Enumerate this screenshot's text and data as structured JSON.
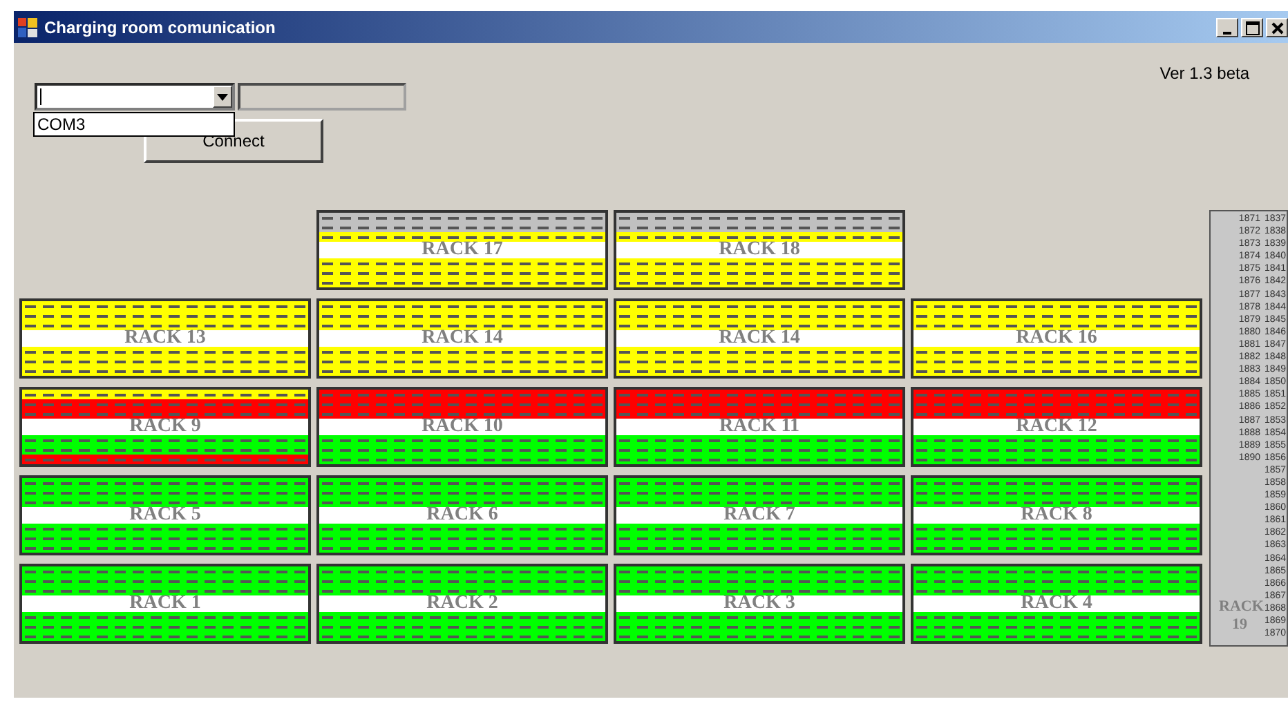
{
  "window": {
    "title": "Charging room comunication"
  },
  "port_select": {
    "expanded": true,
    "options": [
      "COM3"
    ]
  },
  "status_field": {
    "disabled": true
  },
  "connect_button": {
    "label": "Connect"
  },
  "version": "Ver 1.3 beta",
  "rack_rows": [
    {
      "racks": [
        {
          "label": "RACK 17",
          "strips": [
            {
              "color": "#c0c0c0"
            },
            {
              "color": "#c0c0c0"
            },
            {
              "color": "#ffff00"
            },
            {
              "color": "#ffff00"
            },
            {
              "color": "#ffff00"
            },
            {
              "color": "#ffff00"
            }
          ]
        },
        {
          "label": "RACK 18",
          "strips": [
            {
              "color": "#c0c0c0"
            },
            {
              "color": "#c0c0c0"
            },
            {
              "color": "#ffff00"
            },
            {
              "color": "#ffff00"
            },
            {
              "color": "#ffff00"
            },
            {
              "color": "#ffff00"
            }
          ]
        }
      ]
    },
    {
      "racks": [
        {
          "label": "RACK 13",
          "strips": [
            {
              "color": "#ffff00"
            },
            {
              "color": "#ffff00"
            },
            {
              "color": "#ffff00"
            },
            {
              "color": "#ffff00"
            },
            {
              "color": "#ffff00"
            },
            {
              "color": "#ffff00"
            }
          ]
        },
        {
          "label": "RACK 14",
          "strips": [
            {
              "color": "#ffff00"
            },
            {
              "color": "#ffff00"
            },
            {
              "color": "#ffff00"
            },
            {
              "color": "#ffff00"
            },
            {
              "color": "#ffff00"
            },
            {
              "color": "#ffff00"
            }
          ]
        },
        {
          "label": "RACK 14",
          "strips": [
            {
              "color": "#ffff00"
            },
            {
              "color": "#ffff00"
            },
            {
              "color": "#ffff00"
            },
            {
              "color": "#ffff00"
            },
            {
              "color": "#ffff00"
            },
            {
              "color": "#ffff00"
            }
          ]
        },
        {
          "label": "RACK 16",
          "strips": [
            {
              "color": "#ffff00"
            },
            {
              "color": "#ffff00"
            },
            {
              "color": "#ffff00"
            },
            {
              "color": "#ffff00"
            },
            {
              "color": "#ffff00"
            },
            {
              "color": "#ffff00"
            }
          ]
        }
      ]
    },
    {
      "racks": [
        {
          "label": "RACK 9",
          "strips": [
            {
              "color": "#ffff00"
            },
            {
              "color": "#ff0000"
            },
            {
              "color": "#ff0000"
            },
            {
              "color": "#00ff00"
            },
            {
              "color": "#00ff00"
            },
            {
              "color": "#ff0000"
            }
          ]
        },
        {
          "label": "RACK 10",
          "strips": [
            {
              "color": "#ff0000"
            },
            {
              "color": "#ff0000"
            },
            {
              "color": "#ff0000"
            },
            {
              "color": "#00ff00"
            },
            {
              "color": "#00ff00"
            },
            {
              "color": "#00ff00"
            }
          ]
        },
        {
          "label": "RACK 11",
          "strips": [
            {
              "color": "#ff0000"
            },
            {
              "color": "#ff0000"
            },
            {
              "color": "#ff0000"
            },
            {
              "color": "#00ff00"
            },
            {
              "color": "#00ff00"
            },
            {
              "color": "#00ff00"
            }
          ]
        },
        {
          "label": "RACK 12",
          "strips": [
            {
              "color": "#ff0000"
            },
            {
              "color": "#ff0000"
            },
            {
              "color": "#ff0000"
            },
            {
              "color": "#00ff00"
            },
            {
              "color": "#00ff00"
            },
            {
              "color": "#00ff00"
            }
          ]
        }
      ]
    },
    {
      "racks": [
        {
          "label": "RACK 5",
          "strips": [
            {
              "color": "#00ff00"
            },
            {
              "color": "#00ff00"
            },
            {
              "color": "#00ff00"
            },
            {
              "color": "#00ff00"
            },
            {
              "color": "#00ff00"
            },
            {
              "color": "#00ff00"
            }
          ]
        },
        {
          "label": "RACK 6",
          "strips": [
            {
              "color": "#00ff00"
            },
            {
              "color": "#00ff00"
            },
            {
              "color": "#00ff00"
            },
            {
              "color": "#00ff00"
            },
            {
              "color": "#00ff00"
            },
            {
              "color": "#00ff00"
            }
          ]
        },
        {
          "label": "RACK 7",
          "strips": [
            {
              "color": "#00ff00"
            },
            {
              "color": "#00ff00"
            },
            {
              "color": "#00ff00"
            },
            {
              "color": "#00ff00"
            },
            {
              "color": "#00ff00"
            },
            {
              "color": "#00ff00"
            }
          ]
        },
        {
          "label": "RACK 8",
          "strips": [
            {
              "color": "#00ff00"
            },
            {
              "color": "#00ff00"
            },
            {
              "color": "#00ff00"
            },
            {
              "color": "#00ff00"
            },
            {
              "color": "#00ff00"
            },
            {
              "color": "#00ff00"
            }
          ]
        }
      ]
    },
    {
      "racks": [
        {
          "label": "RACK 1",
          "strips": [
            {
              "color": "#00ff00"
            },
            {
              "color": "#00ff00"
            },
            {
              "color": "#00ff00"
            },
            {
              "color": "#00ff00"
            },
            {
              "color": "#00ff00"
            },
            {
              "color": "#00ff00"
            }
          ]
        },
        {
          "label": "RACK 2",
          "strips": [
            {
              "color": "#00ff00"
            },
            {
              "color": "#00ff00"
            },
            {
              "color": "#00ff00"
            },
            {
              "color": "#00ff00"
            },
            {
              "color": "#00ff00"
            },
            {
              "color": "#00ff00"
            }
          ]
        },
        {
          "label": "RACK 3",
          "strips": [
            {
              "color": "#00ff00"
            },
            {
              "color": "#00ff00"
            },
            {
              "color": "#00ff00"
            },
            {
              "color": "#00ff00"
            },
            {
              "color": "#00ff00"
            },
            {
              "color": "#00ff00"
            }
          ]
        },
        {
          "label": "RACK 4",
          "strips": [
            {
              "color": "#00ff00"
            },
            {
              "color": "#00ff00"
            },
            {
              "color": "#00ff00"
            },
            {
              "color": "#00ff00"
            },
            {
              "color": "#00ff00"
            },
            {
              "color": "#00ff00"
            }
          ]
        }
      ]
    }
  ],
  "side_rack": {
    "label": "RACK 19",
    "columns": [
      [
        "1871",
        "1872",
        "1873",
        "1874",
        "1875",
        "1876",
        "1877",
        "1878",
        "1879",
        "1880",
        "1881",
        "1882",
        "1883",
        "1884",
        "1885",
        "1886",
        "1887",
        "1888",
        "1889",
        "1890"
      ],
      [
        "1837",
        "1838",
        "1839",
        "1840",
        "1841",
        "1842",
        "1843",
        "1844",
        "1845",
        "1846",
        "1847",
        "1848",
        "1849",
        "1850",
        "1851",
        "1852",
        "1853",
        "1854",
        "1855",
        "1856",
        "1857",
        "1858",
        "1859",
        "1860",
        "1861",
        "1862",
        "1863",
        "1864",
        "1865",
        "1866",
        "1867",
        "1868",
        "1869",
        "1870"
      ]
    ]
  }
}
